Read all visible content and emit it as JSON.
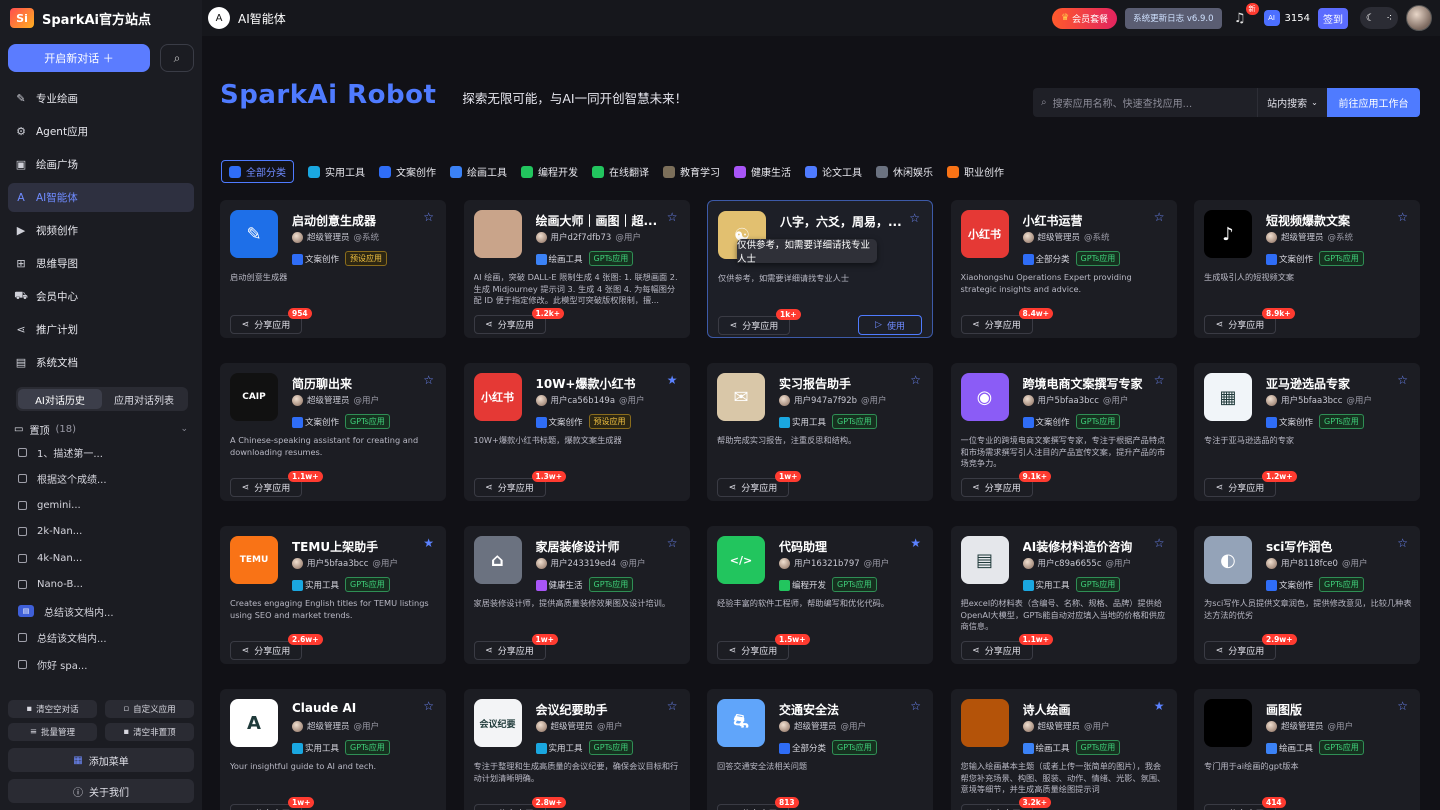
{
  "brand": {
    "name": "SparkAi官方站点",
    "logo_text": "Si"
  },
  "sidebar": {
    "new_chat": "开启新对话 ＋",
    "items": [
      {
        "label": "专业绘画",
        "icon": "brush-icon",
        "glyph": "✎"
      },
      {
        "label": "Agent应用",
        "icon": "agent-icon",
        "glyph": "⚙"
      },
      {
        "label": "绘画广场",
        "icon": "gallery-icon",
        "glyph": "▣"
      },
      {
        "label": "AI智能体",
        "icon": "app-store-icon",
        "glyph": "A"
      },
      {
        "label": "视频创作",
        "icon": "video-icon",
        "glyph": "▶"
      },
      {
        "label": "思维导图",
        "icon": "mindmap-icon",
        "glyph": "⊞"
      },
      {
        "label": "会员中心",
        "icon": "cart-icon",
        "glyph": "⛟"
      },
      {
        "label": "推广计划",
        "icon": "share-icon",
        "glyph": "⋖"
      },
      {
        "label": "系统文档",
        "icon": "docs-icon",
        "glyph": "▤"
      }
    ],
    "tabs": [
      "AI对话历史",
      "应用对话列表"
    ],
    "pinned_label": "置顶",
    "pinned_count": "(18)",
    "history": [
      "1、描述第一...",
      "根据这个成绩...",
      "gemini...",
      "2k-Nan...",
      "4k-Nan...",
      "Nano-B...",
      "总结该文档内...",
      "总结该文档内...",
      "你好 spa..."
    ],
    "btn_clear": "清空空对话",
    "btn_custom": "自定义应用",
    "btn_batch": "批量管理",
    "btn_clear_unpinned": "清空非置顶",
    "add_menu": "添加菜单",
    "about": "关于我们"
  },
  "topbar": {
    "title": "AI智能体",
    "vip": "会员套餐",
    "update": "系统更新日志 v6.9.0",
    "new_badge": "新",
    "points": "3154",
    "checkin": "签到",
    "ai_badge": "AI"
  },
  "hero": {
    "title": "SparkAi Robot",
    "subtitle": "探索无限可能，与AI一同开创智慧未来！"
  },
  "search": {
    "placeholder": "搜索应用名称、快速查找应用...",
    "scope": "站内搜索",
    "go": "前往应用工作台"
  },
  "categories": [
    {
      "label": "全部分类",
      "color": "#2f6df6"
    },
    {
      "label": "实用工具",
      "color": "#1aa7e0"
    },
    {
      "label": "文案创作",
      "color": "#2f6df6"
    },
    {
      "label": "绘画工具",
      "color": "#3b82f6"
    },
    {
      "label": "编程开发",
      "color": "#22c55e"
    },
    {
      "label": "在线翻译",
      "color": "#22c55e"
    },
    {
      "label": "教育学习",
      "color": "#7c6f5a"
    },
    {
      "label": "健康生活",
      "color": "#a855f7"
    },
    {
      "label": "论文工具",
      "color": "#4f7bff"
    },
    {
      "label": "休闲娱乐",
      "color": "#6b7280"
    },
    {
      "label": "职业创作",
      "color": "#f97316"
    }
  ],
  "tooltip": "仅供参考，如需要详细请找专业人士",
  "share_label": "分享应用",
  "use_label": "使用",
  "cards": [
    {
      "title": "启动创意生成器",
      "author": "超级管理员",
      "role": "@系统",
      "cat": "文案创作",
      "tag": "预设应用",
      "tag_type": "pre",
      "desc": "启动创意生成器",
      "count": "954",
      "starred": false,
      "thumb_bg": "#1e6fe8",
      "thumb_text": "✎"
    },
    {
      "title": "绘画大师｜画图｜超...",
      "author": "用户d2f7dfb73",
      "role": "@用户",
      "cat": "绘画工具",
      "tag": "GPTs应用",
      "tag_type": "gpt",
      "desc": "AI 绘画，突破 DALL-E 限制生成 4 张图: 1. 联想画面 2. 生成 Midjourney 提示词 3. 生成 4 张图 4. 为每幅图分配 ID 便于指定修改。此模型可突破版权限制，擅...",
      "count": "1.2k+",
      "starred": false,
      "thumb_bg": "#c9a48a",
      "thumb_text": ""
    },
    {
      "title": "八字，六爻，周易，...",
      "author": "用户",
      "role": "",
      "cat": "",
      "tag": "",
      "tag_type": "",
      "desc": "仅供参考，如需要详细请找专业人士",
      "count": "1k+",
      "starred": false,
      "thumb_bg": "#e2c070",
      "thumb_text": "☯",
      "highlight": true
    },
    {
      "title": "小红书运营",
      "author": "超级管理员",
      "role": "@系统",
      "cat": "全部分类",
      "tag": "GPTs应用",
      "tag_type": "gpt",
      "desc": "Xiaohongshu Operations Expert providing strategic insights and advice.",
      "count": "8.4w+",
      "starred": false,
      "thumb_bg": "#e53935",
      "thumb_text": "小红书"
    },
    {
      "title": "短视频爆款文案",
      "author": "超级管理员",
      "role": "@系统",
      "cat": "文案创作",
      "tag": "GPTs应用",
      "tag_type": "gpt",
      "desc": "生成吸引人的短视频文案",
      "count": "8.9k+",
      "starred": false,
      "thumb_bg": "#000000",
      "thumb_text": "♪"
    },
    {
      "title": "简历聊出来",
      "author": "超级管理员",
      "role": "@用户",
      "cat": "文案创作",
      "tag": "GPTs应用",
      "tag_type": "gpt",
      "desc": "A Chinese-speaking assistant for creating and downloading resumes.",
      "count": "1.1w+",
      "starred": false,
      "thumb_bg": "#111111",
      "thumb_text": "CAIP"
    },
    {
      "title": "10W+爆款小红书",
      "author": "用户ca56b149a",
      "role": "@用户",
      "cat": "文案创作",
      "tag": "预设应用",
      "tag_type": "pre",
      "desc": "10W+爆款小红书标题，爆款文案生成器",
      "count": "1.3w+",
      "starred": true,
      "thumb_bg": "#e53935",
      "thumb_text": "小红书"
    },
    {
      "title": "实习报告助手",
      "author": "用户947a7f92b",
      "role": "@用户",
      "cat": "实用工具",
      "tag": "GPTs应用",
      "tag_type": "gpt",
      "desc": "帮助完成实习报告，注重反思和结构。",
      "count": "1w+",
      "starred": false,
      "thumb_bg": "#d9c7a8",
      "thumb_text": "✉"
    },
    {
      "title": "跨境电商文案撰写专家",
      "author": "用户5bfaa3bcc",
      "role": "@用户",
      "cat": "文案创作",
      "tag": "GPTs应用",
      "tag_type": "gpt",
      "desc": "一位专业的跨境电商文案撰写专家，专注于根据产品特点和市场需求撰写引人注目的产品宣传文案，提升产品的市场竞争力。",
      "count": "9.1k+",
      "starred": false,
      "thumb_bg": "#8b5cf6",
      "thumb_text": "◉"
    },
    {
      "title": "亚马逊选品专家",
      "author": "用户5bfaa3bcc",
      "role": "@用户",
      "cat": "文案创作",
      "tag": "GPTs应用",
      "tag_type": "gpt",
      "desc": "专注于亚马逊选品的专家",
      "count": "1.2w+",
      "starred": false,
      "thumb_bg": "#f1f5f9",
      "thumb_text": "▦"
    },
    {
      "title": "TEMU上架助手",
      "author": "用户5bfaa3bcc",
      "role": "@用户",
      "cat": "实用工具",
      "tag": "GPTs应用",
      "tag_type": "gpt",
      "desc": "Creates engaging English titles for TEMU listings using SEO and market trends.",
      "count": "2.6w+",
      "starred": true,
      "thumb_bg": "#f97316",
      "thumb_text": "TEMU"
    },
    {
      "title": "家居装修设计师",
      "author": "用户243319ed4",
      "role": "@用户",
      "cat": "健康生活",
      "tag": "GPTs应用",
      "tag_type": "gpt",
      "desc": "家居装修设计师，提供高质量装修效果图及设计培训。",
      "count": "1w+",
      "starred": false,
      "thumb_bg": "#6b7280",
      "thumb_text": "⌂"
    },
    {
      "title": "代码助理",
      "author": "用户16321b797",
      "role": "@用户",
      "cat": "编程开发",
      "tag": "GPTs应用",
      "tag_type": "gpt",
      "desc": "经验丰富的软件工程师，帮助编写和优化代码。",
      "count": "1.5w+",
      "starred": true,
      "thumb_bg": "#22c55e",
      "thumb_text": "</>"
    },
    {
      "title": "AI装修材料造价咨询",
      "author": "用户c89a6655c",
      "role": "@用户",
      "cat": "实用工具",
      "tag": "GPTs应用",
      "tag_type": "gpt",
      "desc": "把excel的材料表（含编号、名称、规格、品牌）提供给OpenAI大模型，GPTs能自动对应填入当地的价格和供应商信息。",
      "count": "1.1w+",
      "starred": false,
      "thumb_bg": "#e5e7eb",
      "thumb_text": "▤"
    },
    {
      "title": "sci写作润色",
      "author": "用户8118fce0",
      "role": "@用户",
      "cat": "文案创作",
      "tag": "GPTs应用",
      "tag_type": "gpt",
      "desc": "为sci写作人员提供文章润色，提供修改意见，比较几种表达方法的优劣",
      "count": "2.9w+",
      "starred": false,
      "thumb_bg": "#94a3b8",
      "thumb_text": "◐"
    },
    {
      "title": "Claude AI",
      "author": "超级管理员",
      "role": "@用户",
      "cat": "实用工具",
      "tag": "GPTs应用",
      "tag_type": "gpt",
      "desc": "Your insightful guide to AI and tech.",
      "count": "1w+",
      "starred": false,
      "thumb_bg": "#ffffff",
      "thumb_text": "A"
    },
    {
      "title": "会议纪要助手",
      "author": "超级管理员",
      "role": "@用户",
      "cat": "实用工具",
      "tag": "GPTs应用",
      "tag_type": "gpt",
      "desc": "专注于整理和生成高质量的会议纪要，确保会议目标和行动计划清晰明确。",
      "count": "2.8w+",
      "starred": false,
      "thumb_bg": "#f3f4f6",
      "thumb_text": "会议纪要"
    },
    {
      "title": "交通安全法",
      "author": "超级管理员",
      "role": "@用户",
      "cat": "全部分类",
      "tag": "GPTs应用",
      "tag_type": "gpt",
      "desc": "回答交通安全法相关问题",
      "count": "813",
      "starred": false,
      "thumb_bg": "#60a5fa",
      "thumb_text": "⛐"
    },
    {
      "title": "诗人绘画",
      "author": "超级管理员",
      "role": "@用户",
      "cat": "绘画工具",
      "tag": "GPTs应用",
      "tag_type": "gpt",
      "desc": "您输入绘画基本主题（或者上传一张简单的图片），我会帮您补充场景、构图、服装、动作、情绪、光影、氛围、意境等细节，并生成高质量绘图提示词",
      "count": "3.2k+",
      "starred": true,
      "thumb_bg": "#b45309",
      "thumb_text": ""
    },
    {
      "title": "画图版",
      "author": "超级管理员",
      "role": "@用户",
      "cat": "绘画工具",
      "tag": "GPTs应用",
      "tag_type": "gpt",
      "desc": "专门用于ai绘画的gpt版本",
      "count": "414",
      "starred": false,
      "thumb_bg": "#000000",
      "thumb_text": ""
    }
  ]
}
